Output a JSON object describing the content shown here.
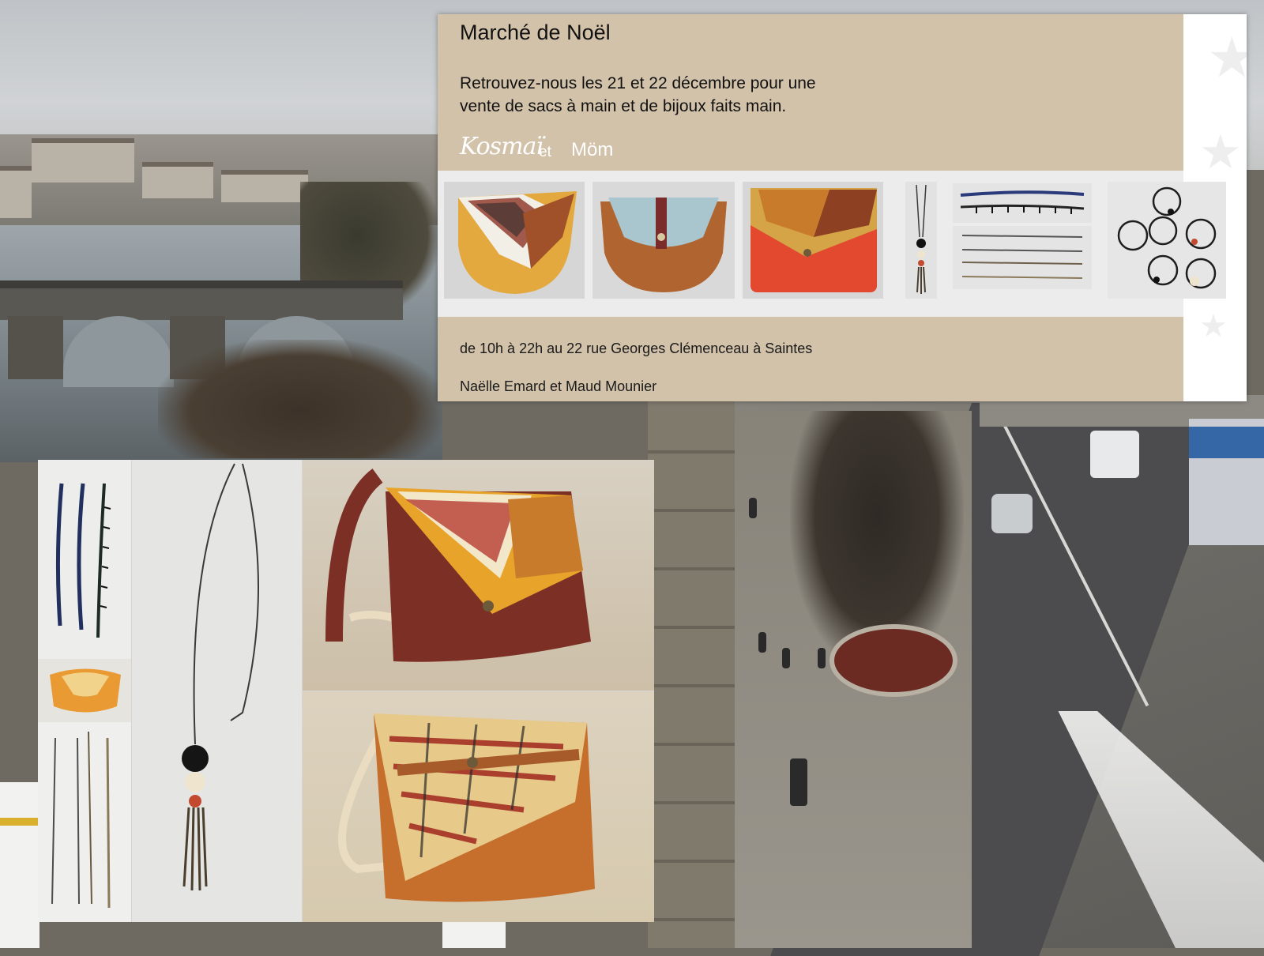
{
  "flyer": {
    "title": "Marché de Noël",
    "line1": "Retrouvez-nous les 21 et 22 décembre pour une",
    "line2": "vente de sacs à main et de bijoux faits main.",
    "brand_left": "Kosmaï",
    "brand_joiner": "et",
    "brand_right": "Möm",
    "info": "de 10h à 22h au 22 rue Georges Clémenceau à Saintes",
    "names": "Naëlle Emard et Maud Mounier"
  },
  "colors": {
    "flyer_bg": "#d3c2aa",
    "bag_ochre": "#e0a63a",
    "bag_rust": "#a65a2a",
    "bag_red": "#e2492f",
    "bag_burgundy": "#7c2f24"
  },
  "images": {
    "background": "aerial-photo-river-town-and-christmas-market",
    "bags": [
      "ochre-leather-bag",
      "rust-suede-bag",
      "red-leather-bag"
    ],
    "jewelry": [
      "pendant-necklace",
      "beaded-bracelets",
      "chain-bracelets",
      "cord-bracelets"
    ],
    "collage": [
      "beaded-bracelets",
      "mini-orange-bag",
      "chain-bracelets",
      "tassel-necklace",
      "burgundy-bag",
      "orange-print-bag"
    ]
  }
}
